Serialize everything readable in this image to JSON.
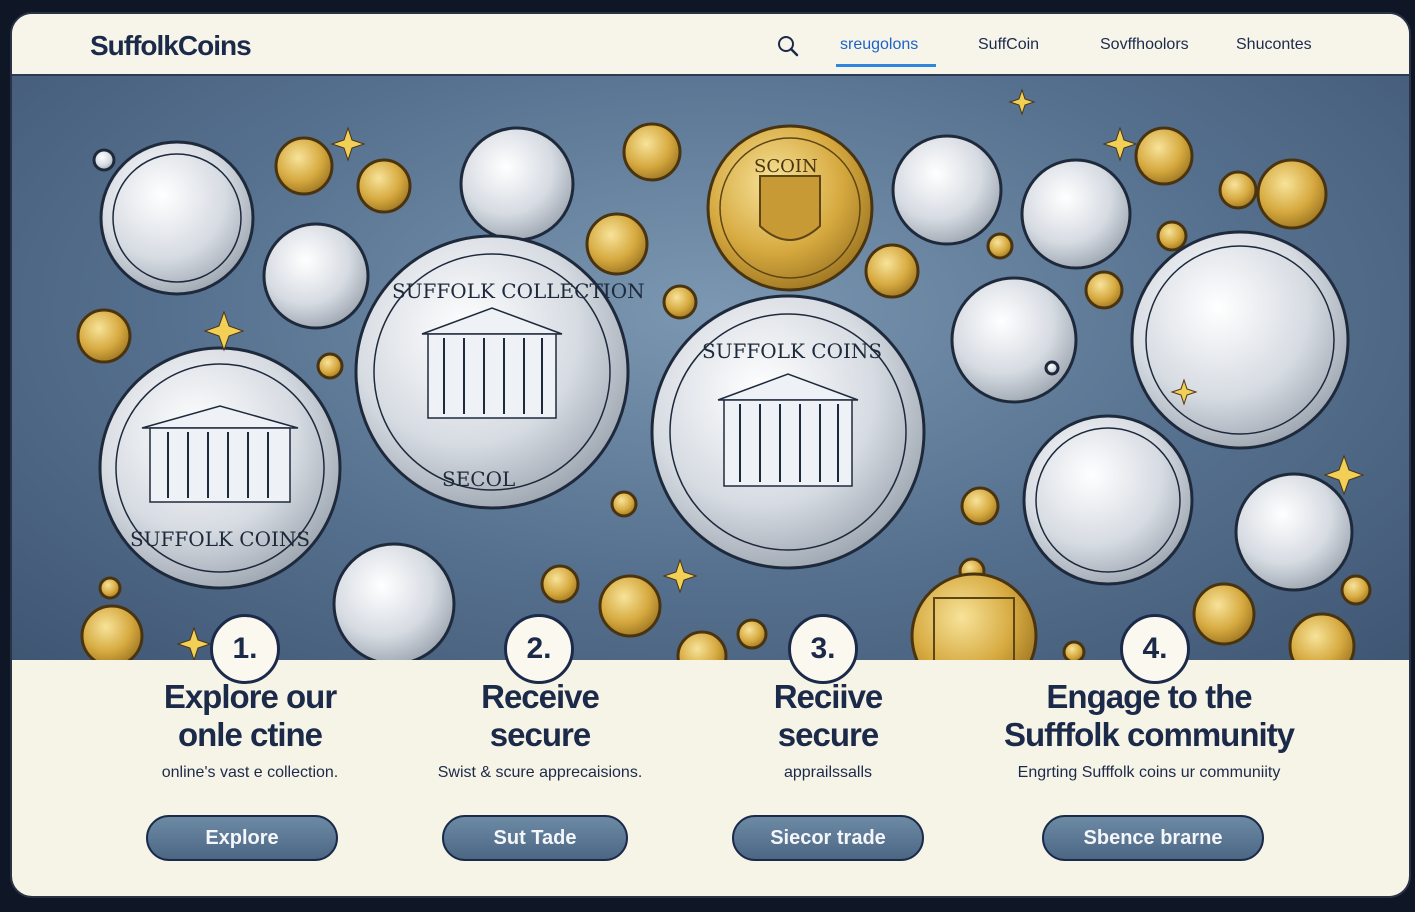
{
  "brand": "SuffolkCoins",
  "nav": {
    "search_icon": "search-icon",
    "items": [
      {
        "label": "sreugolons"
      },
      {
        "label": "SuffCoin"
      },
      {
        "label": "Sovffhoolors"
      },
      {
        "label": "Shucontes"
      }
    ]
  },
  "hero": {
    "coin_legends": {
      "big_left": "SUFFOLK COINS",
      "big_mid": "SUFFOLK COLLECTION",
      "big_center": "SUFFOLK COINS",
      "top_gold": "SCOIN",
      "bottom_small": "SECOL"
    }
  },
  "steps": [
    {
      "number": "1.",
      "title_line1": "Explore our",
      "title_line2": "onle ctine",
      "desc": "online's vast e collection.",
      "button": "Explore"
    },
    {
      "number": "2.",
      "title_line1": "Receive",
      "title_line2": "secure",
      "desc": "Swist & scure apprecaisions.",
      "button": "Sut Tade"
    },
    {
      "number": "3.",
      "title_line1": "Reciive",
      "title_line2": "secure",
      "desc": "apprailssalls",
      "button": "Siecor trade"
    },
    {
      "number": "4.",
      "title_line1": "Engage to the",
      "title_line2": "Sufffolk community",
      "desc": "Engrting Sufffolk coins ur communiity",
      "button": "Sbence brarne"
    }
  ],
  "colors": {
    "accent": "#2f86e0",
    "navy": "#1c2a4a",
    "button": "#5a7694",
    "background": "#f6f3e7"
  }
}
